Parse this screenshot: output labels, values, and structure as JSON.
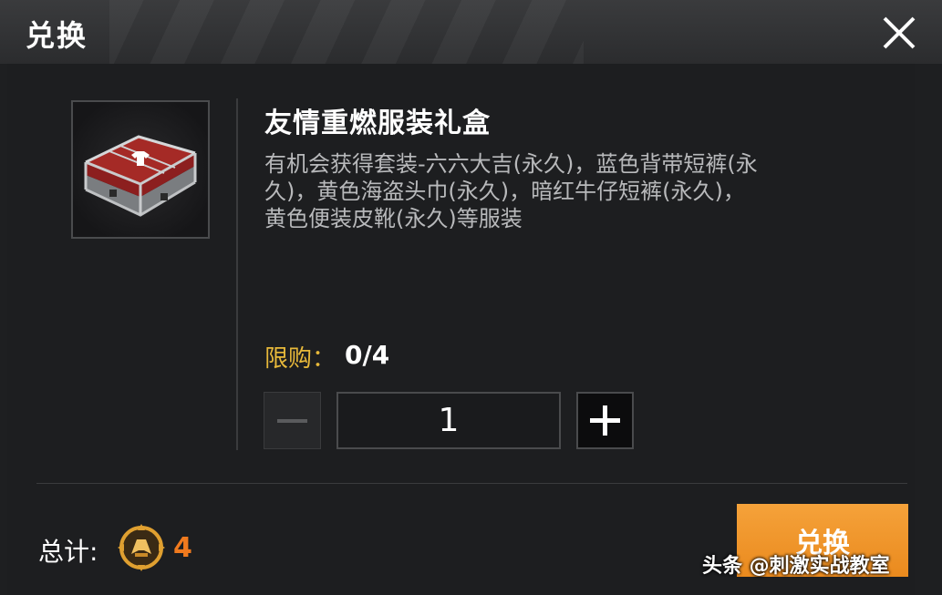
{
  "dialog": {
    "title": "兑换",
    "close_icon": "close-icon"
  },
  "item": {
    "name": "友情重燃服装礼盒",
    "description": "有机会获得套装-六六大吉(永久)，蓝色背带短裤(永久)，黄色海盗头巾(永久)，暗红牛仔短裤(永久)，黄色便装皮靴(永久)等服装",
    "image_icon": "gift-box-icon"
  },
  "purchase": {
    "limit_label": "限购：",
    "limit_value": "0/4",
    "quantity": "1",
    "minus_icon": "minus-icon",
    "plus_icon": "plus-icon"
  },
  "footer": {
    "total_label": "总计:",
    "currency_icon": "coin-icon",
    "total_value": "4",
    "redeem_label": "兑换"
  },
  "watermark": "头条 @刺激实战教室",
  "colors": {
    "accent": "#ea8a1e",
    "limit": "#e8b93a",
    "total": "#f07a1e"
  }
}
